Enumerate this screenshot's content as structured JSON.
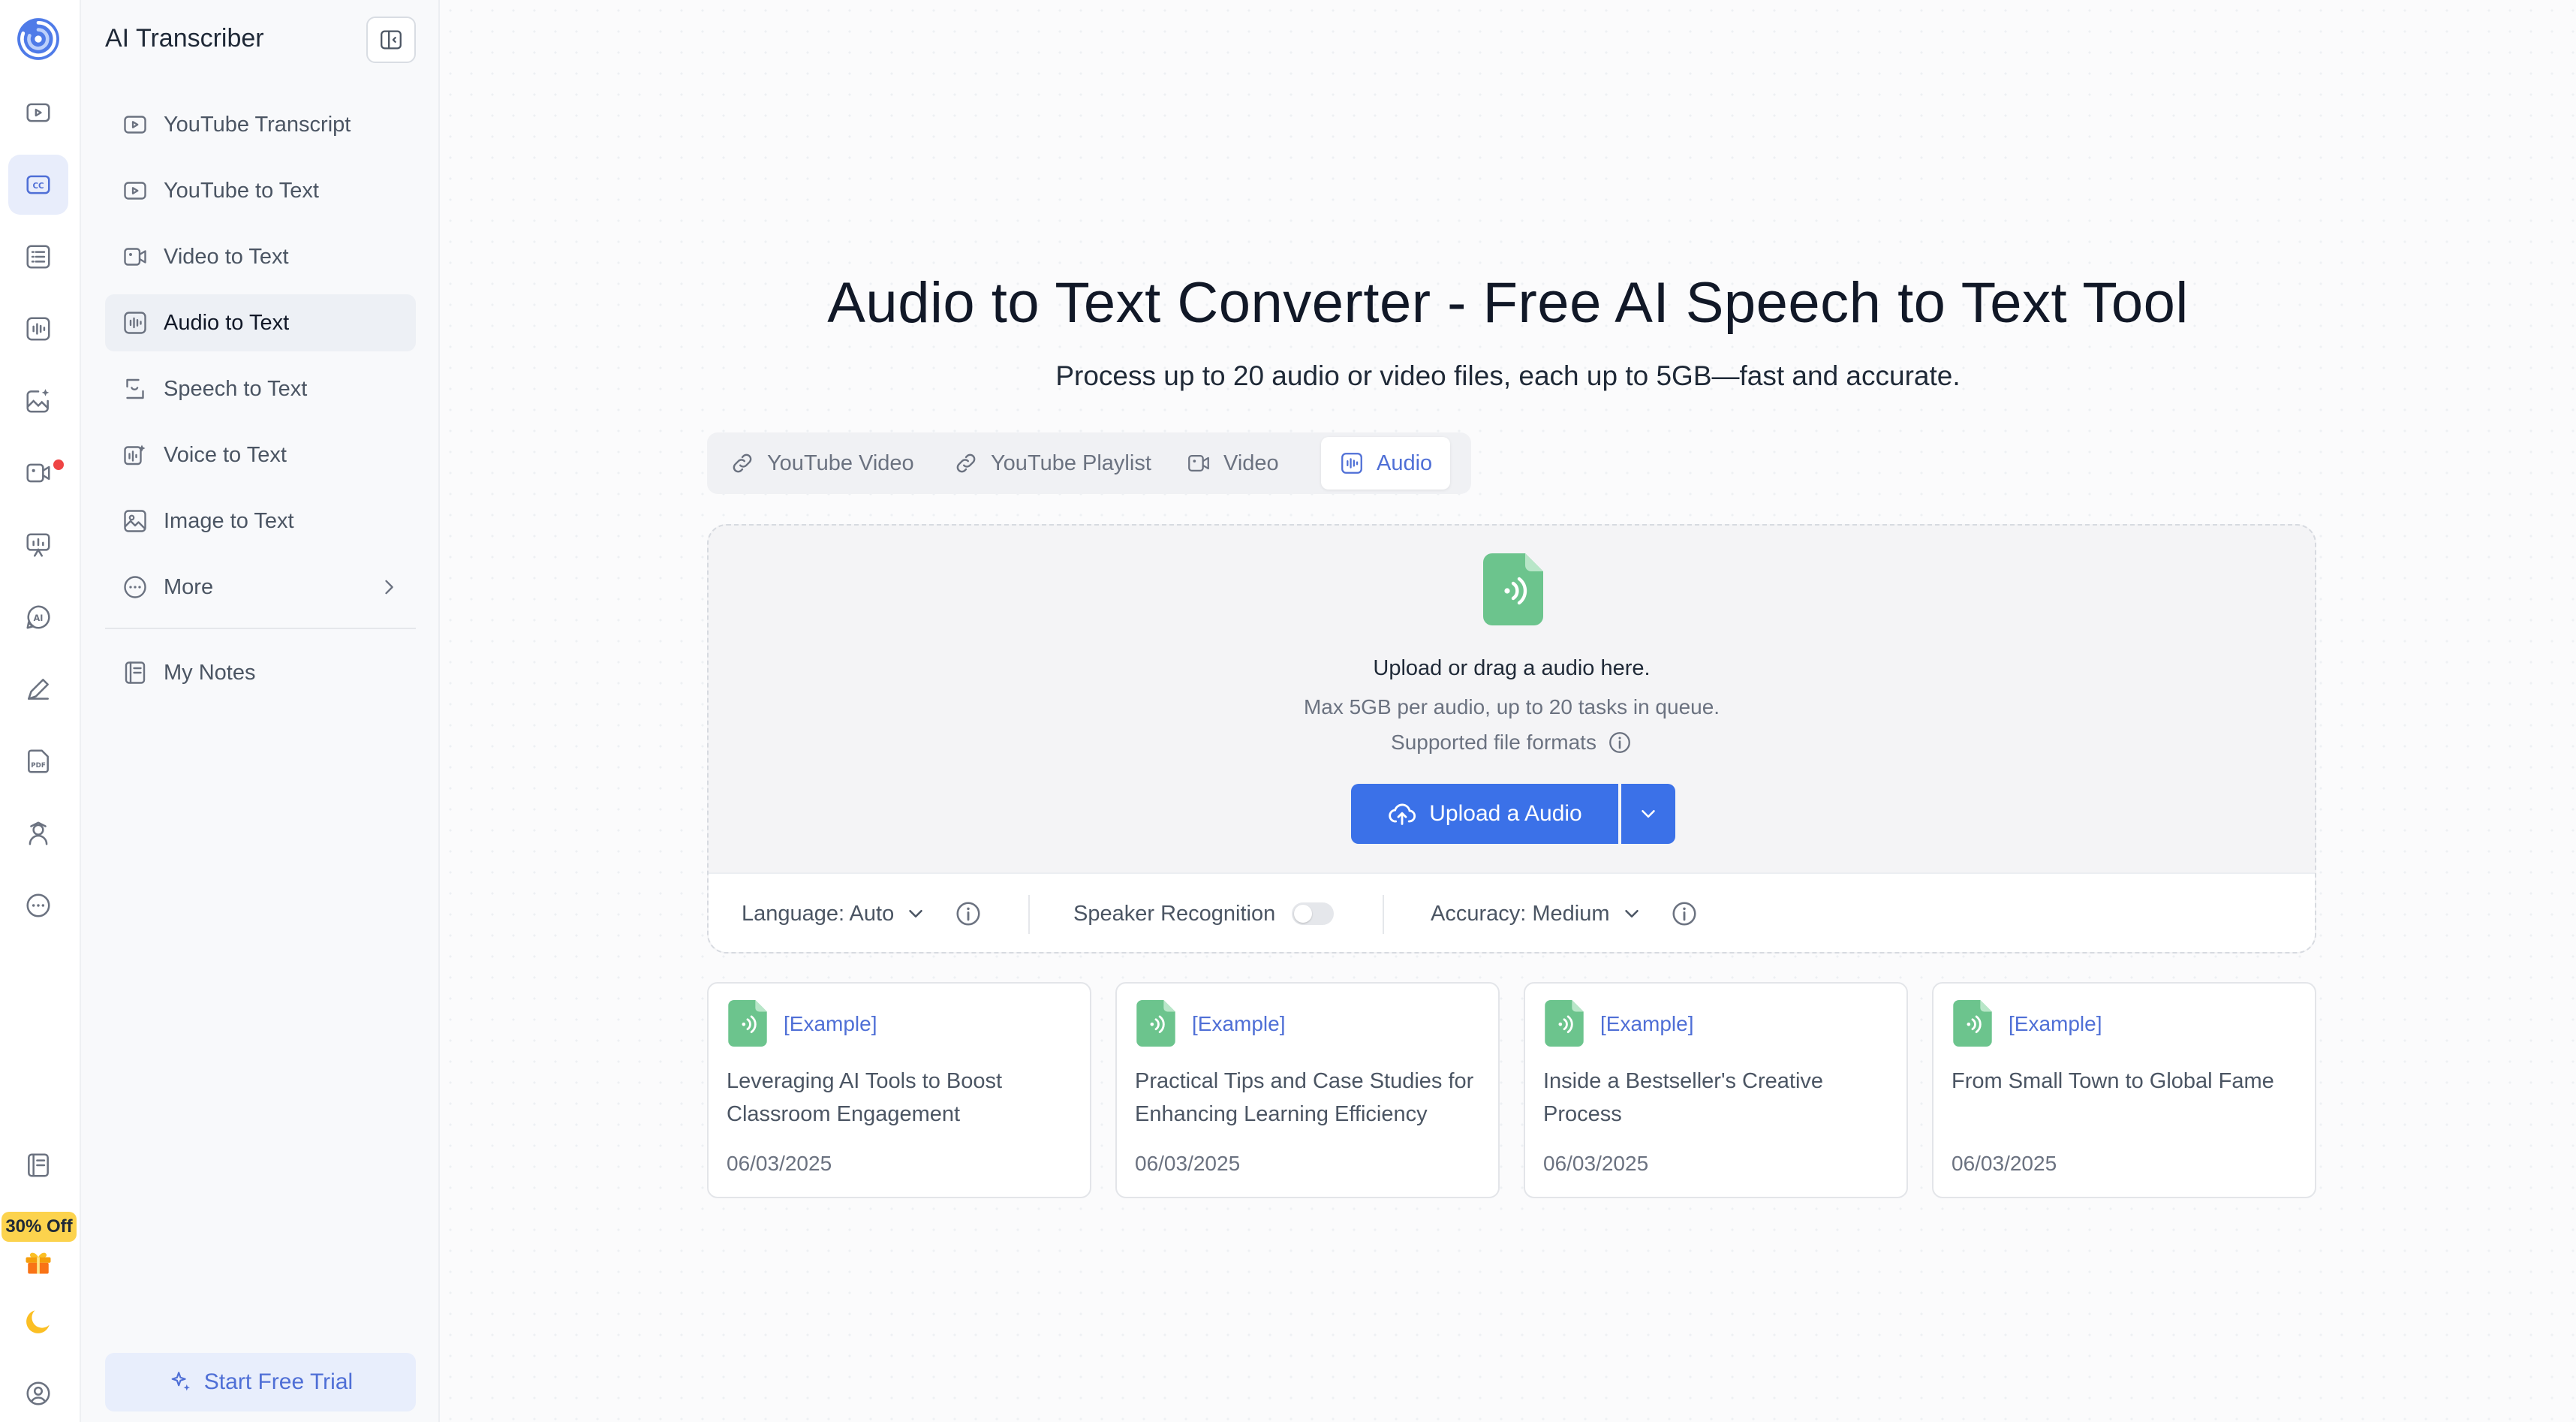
{
  "rail": {
    "promo_badge": "30% Off",
    "icons": [
      "logo-icon",
      "youtube-icon",
      "captions-icon",
      "list-icon",
      "audio-wave-icon",
      "edit-image-icon",
      "video-ai-icon",
      "presentation-icon",
      "ai-chat-icon",
      "pen-icon",
      "pdf-icon",
      "graduation-icon",
      "more-icon",
      "notes-icon",
      "gift-icon",
      "moon-icon",
      "user-icon"
    ]
  },
  "nav": {
    "title": "AI Transcriber",
    "items": [
      {
        "label": "YouTube Transcript",
        "icon": "youtube-icon"
      },
      {
        "label": "YouTube to Text",
        "icon": "youtube-icon"
      },
      {
        "label": "Video to Text",
        "icon": "video-icon"
      },
      {
        "label": "Audio to Text",
        "icon": "audio-wave-icon",
        "active": true
      },
      {
        "label": "Speech to Text",
        "icon": "speech-icon"
      },
      {
        "label": "Voice to Text",
        "icon": "voice-icon"
      },
      {
        "label": "Image to Text",
        "icon": "image-icon"
      },
      {
        "label": "More",
        "icon": "more-icon"
      }
    ],
    "notes_label": "My Notes",
    "trial_label": "Start Free Trial"
  },
  "main": {
    "title": "Audio to Text Converter - Free AI Speech to Text Tool",
    "subtitle": "Process up to 20 audio or video files, each up to 5GB—fast and accurate.",
    "tabs": [
      {
        "label": "YouTube Video",
        "icon": "link-icon"
      },
      {
        "label": "YouTube Playlist",
        "icon": "link-icon"
      },
      {
        "label": "Video",
        "icon": "video-icon"
      },
      {
        "label": "Audio",
        "icon": "audio-wave-icon",
        "active": true
      }
    ],
    "upload": {
      "hint": "Upload or drag a audio here.",
      "limits": "Max 5GB per audio, up to 20 tasks in queue.",
      "formats_label": "Supported file formats",
      "button_label": "Upload a Audio"
    },
    "options": {
      "language": "Language: Auto",
      "speaker": "Speaker Recognition",
      "speaker_enabled": false,
      "accuracy": "Accuracy: Medium"
    },
    "examples": [
      {
        "tag": "[Example]",
        "title": "Leveraging AI Tools to Boost Classroom Engagement",
        "date": "06/03/2025"
      },
      {
        "tag": "[Example]",
        "title": "Practical Tips and Case Studies for Enhancing Learning Efficiency",
        "date": "06/03/2025"
      },
      {
        "tag": "[Example]",
        "title": "Inside a Bestseller's Creative Process",
        "date": "06/03/2025"
      },
      {
        "tag": "[Example]",
        "title": "From Small Town to Global Fame",
        "date": "06/03/2025"
      }
    ]
  },
  "colors": {
    "accent": "#3b71e8",
    "accent_text": "#4f6fd6",
    "file_green": "#6cc48d",
    "promo": "#fcd34d"
  }
}
